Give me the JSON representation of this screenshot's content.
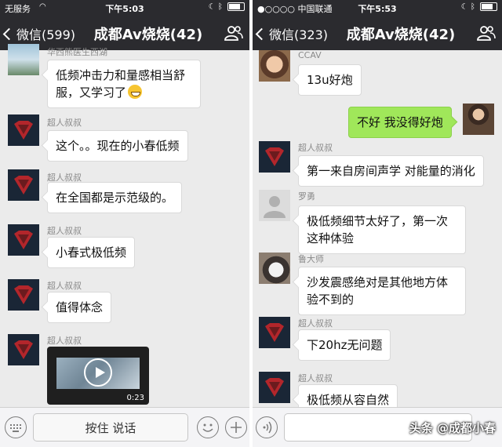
{
  "left": {
    "status": {
      "carrier": "无服务",
      "time": "下午5:03"
    },
    "nav": {
      "back_label": "微信(599)",
      "title": "成都Av烧烧(42)"
    },
    "messages": [
      {
        "sender": "华西熊医生西湖",
        "text_line1": "低频冲击力和量感相当舒",
        "text_line2": "服，又学习了"
      },
      {
        "sender": "超人叔叔",
        "text": "这个。。现在的小春低频"
      },
      {
        "sender": "超人叔叔",
        "text": "在全国都是示范级的。"
      },
      {
        "sender": "超人叔叔",
        "text": "小春式极低频"
      },
      {
        "sender": "超人叔叔",
        "text": "值得体念"
      },
      {
        "sender": "超人叔叔",
        "video_duration": "0:23"
      }
    ],
    "input": {
      "hold_to_talk": "按住 说话"
    }
  },
  "right": {
    "status": {
      "carrier": "●○○○○ 中国联通",
      "time": "下午5:53"
    },
    "nav": {
      "back_label": "微信(323)",
      "title": "成都Av烧烧(42)"
    },
    "messages": [
      {
        "sender": "CCAV",
        "text": "13u好炮"
      },
      {
        "sender": "",
        "text": "不好 我没得好炮"
      },
      {
        "sender": "超人叔叔",
        "text": "第一来自房间声学 对能量的消化"
      },
      {
        "sender": "罗勇",
        "text_line1": "极低频细节太好了，第一次",
        "text_line2": "这种体验"
      },
      {
        "sender": "鲁大师",
        "text_line1": "沙发震感绝对是其他地方体",
        "text_line2": "验不到的"
      },
      {
        "sender": "超人叔叔",
        "text": "下20hz无问题"
      },
      {
        "sender": "超人叔叔",
        "text": "极低频从容自然"
      }
    ],
    "watermark": "头条 @成都小春"
  },
  "colors": {
    "nav_bg": "#2b2b2f",
    "chat_bg": "#ebebeb",
    "sent_bubble": "#a0e75a",
    "received_bubble": "#ffffff"
  }
}
